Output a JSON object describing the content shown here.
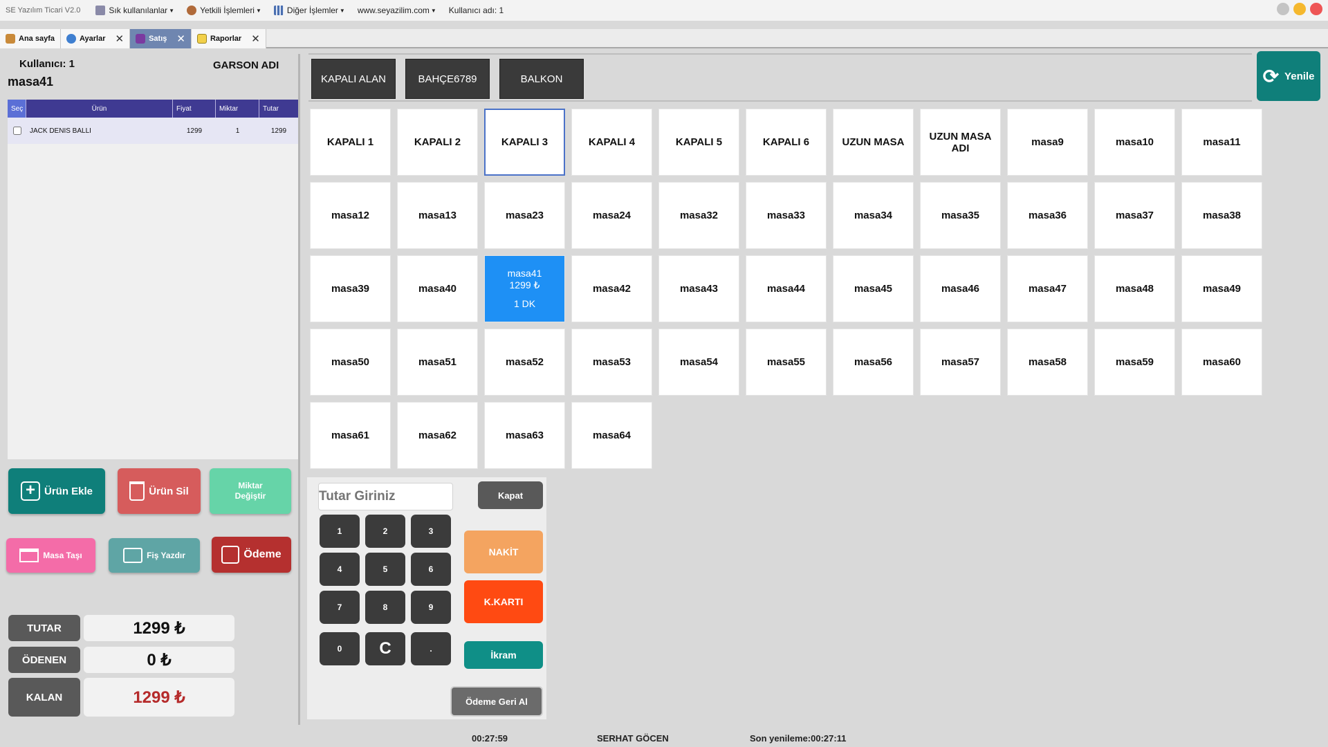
{
  "app": {
    "title": "SE Yazılım Ticari V2.0",
    "menu": [
      {
        "label": "Sık kullanılanlar",
        "icon": "favorites-icon"
      },
      {
        "label": "Yetkili İşlemleri",
        "icon": "admin-icon"
      },
      {
        "label": "Diğer İşlemler",
        "icon": "grid-icon"
      },
      {
        "label": "www.seyazilim.com",
        "icon": ""
      },
      {
        "label": "Kullanıcı adı: 1",
        "icon": ""
      }
    ],
    "window_dot_colors": [
      "#c4c4c4",
      "#f5b82e",
      "#ee5555"
    ]
  },
  "tabs": [
    {
      "label": "Ana sayfa",
      "icon": "home-icon",
      "closable": false,
      "active": false
    },
    {
      "label": "Ayarlar",
      "icon": "settings-icon",
      "closable": true,
      "active": false
    },
    {
      "label": "Satış",
      "icon": "sales-icon",
      "closable": true,
      "active": true
    },
    {
      "label": "Raporlar",
      "icon": "reports-icon",
      "closable": true,
      "active": false
    }
  ],
  "order": {
    "user_label": "Kullanıcı: 1",
    "waiter_label": "GARSON ADI",
    "table_name": "masa41",
    "columns": [
      "Seç",
      "Ürün",
      "Fiyat",
      "Miktar",
      "Tutar"
    ],
    "rows": [
      {
        "checked": false,
        "product": "JACK DENIS BALLI",
        "price": "1299",
        "qty": "1",
        "total": "1299"
      }
    ]
  },
  "actions": {
    "add_product": "Ürün Ekle",
    "delete_product": "Ürün Sil",
    "change_qty_1": "Miktar",
    "change_qty_2": "Değiştir",
    "move_table": "Masa Taşı",
    "print_receipt": "Fiş Yazdır",
    "payment": "Ödeme"
  },
  "totals": {
    "total_label": "TUTAR",
    "total_value": "1299 ₺",
    "paid_label": "ÖDENEN",
    "paid_value": "0 ₺",
    "remaining_label": "KALAN",
    "remaining_value": "1299 ₺"
  },
  "areas": [
    "KAPALI ALAN",
    "BAHÇE6789",
    "BALKON"
  ],
  "refresh_label": "Yenile",
  "tables": [
    {
      "name": "KAPALI 1"
    },
    {
      "name": "KAPALI 2"
    },
    {
      "name": "KAPALI 3",
      "selected": true
    },
    {
      "name": "KAPALI 4"
    },
    {
      "name": "KAPALI 5"
    },
    {
      "name": "KAPALI 6"
    },
    {
      "name": "UZUN MASA"
    },
    {
      "name": "UZUN MASA ADI"
    },
    {
      "name": "masa9"
    },
    {
      "name": "masa10"
    },
    {
      "name": "masa11"
    },
    {
      "name": "masa12"
    },
    {
      "name": "masa13"
    },
    {
      "name": "masa23"
    },
    {
      "name": "masa24"
    },
    {
      "name": "masa32"
    },
    {
      "name": "masa33"
    },
    {
      "name": "masa34"
    },
    {
      "name": "masa35"
    },
    {
      "name": "masa36"
    },
    {
      "name": "masa37"
    },
    {
      "name": "masa38"
    },
    {
      "name": "masa39"
    },
    {
      "name": "masa40"
    },
    {
      "name": "masa41",
      "occupied": true,
      "amount": "1299 ₺",
      "time": "1 DK"
    },
    {
      "name": "masa42"
    },
    {
      "name": "masa43"
    },
    {
      "name": "masa44"
    },
    {
      "name": "masa45"
    },
    {
      "name": "masa46"
    },
    {
      "name": "masa47"
    },
    {
      "name": "masa48"
    },
    {
      "name": "masa49"
    },
    {
      "name": "masa50"
    },
    {
      "name": "masa51"
    },
    {
      "name": "masa52"
    },
    {
      "name": "masa53"
    },
    {
      "name": "masa54"
    },
    {
      "name": "masa55"
    },
    {
      "name": "masa56"
    },
    {
      "name": "masa57"
    },
    {
      "name": "masa58"
    },
    {
      "name": "masa59"
    },
    {
      "name": "masa60"
    },
    {
      "name": "masa61"
    },
    {
      "name": "masa62"
    },
    {
      "name": "masa63"
    },
    {
      "name": "masa64"
    }
  ],
  "payment": {
    "amount_placeholder": "Tutar Giriniz",
    "keys": [
      "1",
      "2",
      "3",
      "4",
      "5",
      "6",
      "7",
      "8",
      "9",
      "0",
      "C",
      "."
    ],
    "close_label": "Kapat",
    "cash_label": "NAKİT",
    "card_label": "K.KARTI",
    "treat_label": "İkram",
    "undo_label": "Ödeme Geri Al"
  },
  "colors": {
    "add_product": "#0f7f7a",
    "delete_product": "#d65c5c",
    "change_qty": "#66d4a8",
    "move_table": "#f46ca8",
    "print_receipt": "#5fa5a5",
    "payment": "#b5302f",
    "cash": "#f4a460",
    "card": "#ff4a12",
    "treat": "#0f8f87",
    "remaining_text": "#b52a2a",
    "occupied_table": "#1e90f5"
  },
  "status": {
    "clock": "00:27:59",
    "user": "SERHAT GÖCEN",
    "last_refresh": "Son yenileme:00:27:11"
  }
}
